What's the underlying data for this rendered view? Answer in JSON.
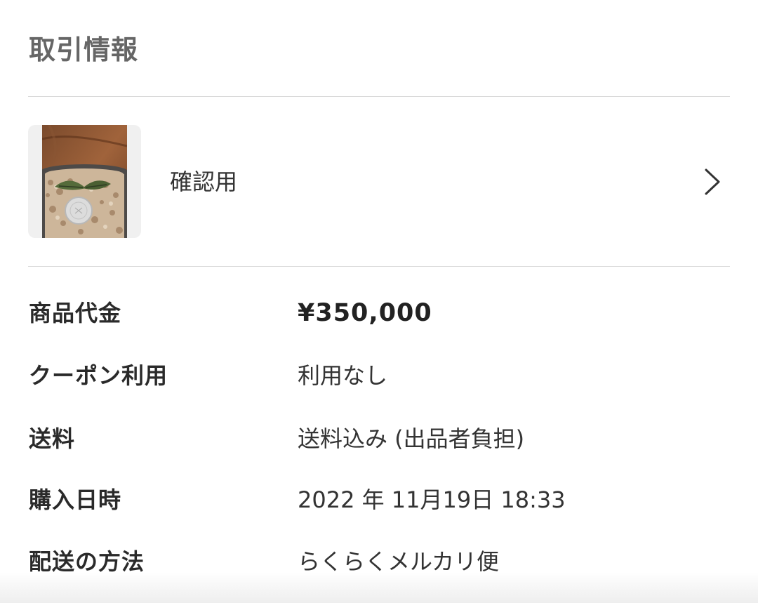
{
  "section": {
    "title": "取引情報"
  },
  "item": {
    "name": "確認用",
    "thumbnail_icon": "product-photo",
    "chevron_icon": "chevron-right-icon"
  },
  "details": {
    "price": {
      "label": "商品代金",
      "value": "¥350,000"
    },
    "coupon": {
      "label": "クーポン利用",
      "value": "利用なし"
    },
    "shipping_fee": {
      "label": "送料",
      "value": "送料込み (出品者負担)"
    },
    "purchase_datetime": {
      "label": "購入日時",
      "value": "2022 年 11月19日 18:33"
    },
    "shipping_method": {
      "label": "配送の方法",
      "value": "らくらくメルカリ便"
    }
  },
  "colors": {
    "title": "#666666",
    "divider": "#d9d9d9",
    "label": "#2a2a2a",
    "value": "#333333"
  }
}
